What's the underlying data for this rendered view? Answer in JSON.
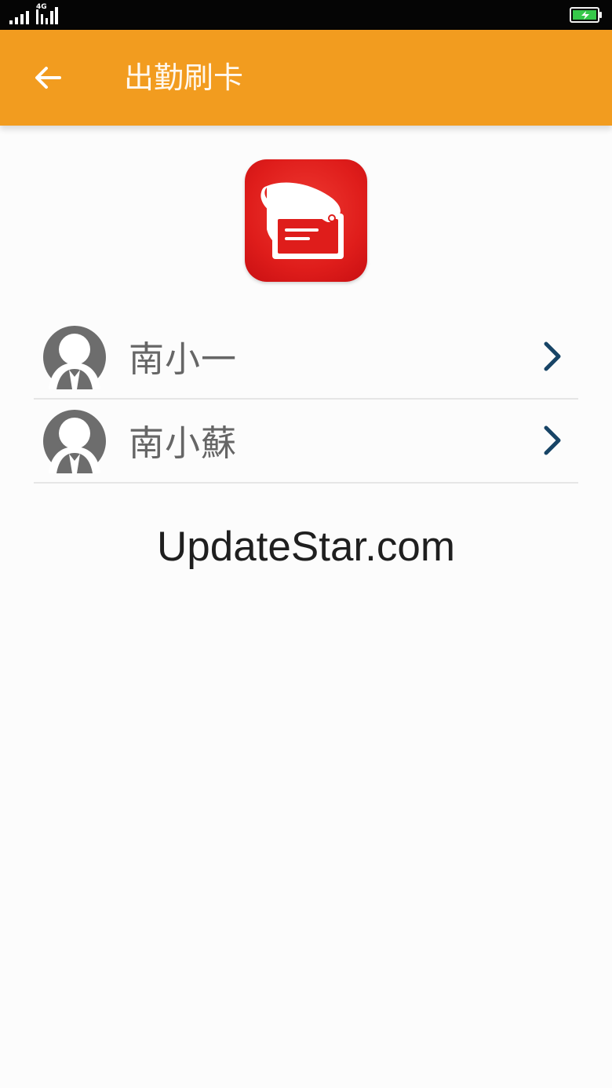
{
  "status_bar": {
    "network_label": "4G",
    "battery_icon": "battery-charging-icon",
    "signal_icon": "signal-bars-icon"
  },
  "header": {
    "title": "出勤刷卡",
    "back_icon": "arrow-left-icon",
    "background_color": "#f29c1f"
  },
  "app_logo": {
    "icon": "card-swipe-icon",
    "color": "#df1d1b"
  },
  "people": [
    {
      "name": "南小一",
      "avatar_icon": "person-avatar-icon",
      "chevron_icon": "chevron-right-icon"
    },
    {
      "name": "南小蘇",
      "avatar_icon": "person-avatar-icon",
      "chevron_icon": "chevron-right-icon"
    }
  ],
  "watermark": "UpdateStar.com",
  "colors": {
    "chevron": "#174466",
    "text_muted": "#666666",
    "divider": "#e6e6e6"
  }
}
